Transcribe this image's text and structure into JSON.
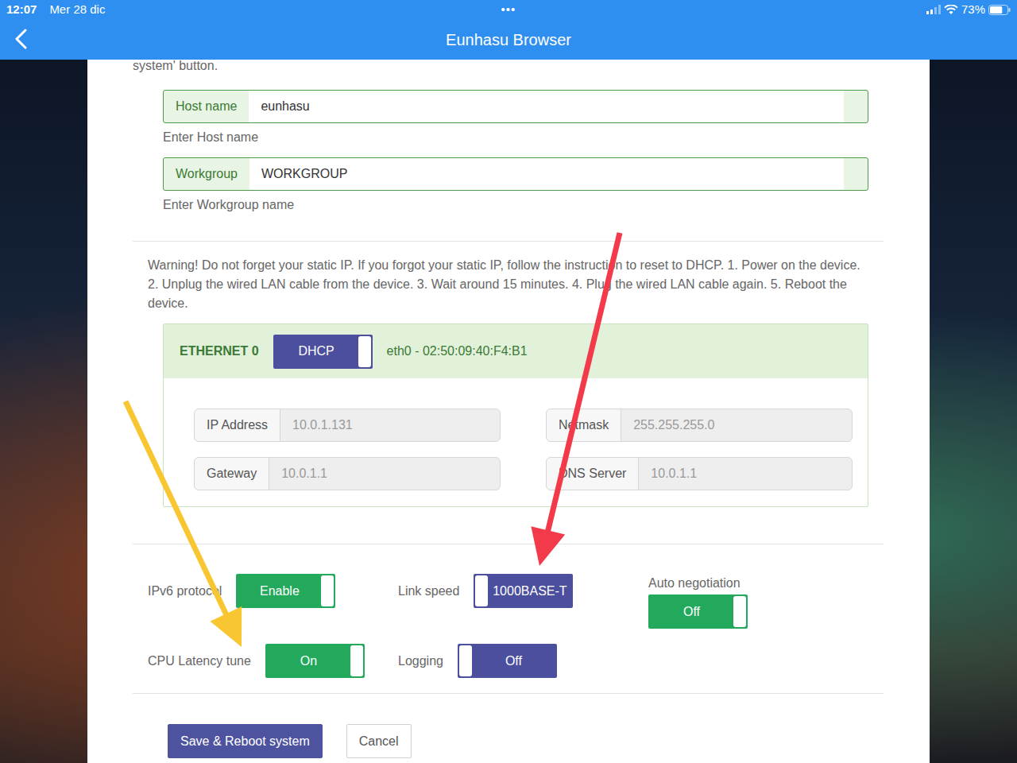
{
  "status_bar": {
    "time": "12:07",
    "date": "Mer 28 dic",
    "dots": "•••",
    "battery": "73%",
    "battery_level": 0.73
  },
  "nav_bar": {
    "title": "Eunhasu Browser"
  },
  "intro_tail": "system' button.",
  "fields": [
    {
      "label": "Host name",
      "value": "eunhasu",
      "help": "Enter Host name"
    },
    {
      "label": "Workgroup",
      "value": "WORKGROUP",
      "help": "Enter Workgroup name"
    }
  ],
  "warning": "Warning! Do not forget your static IP. If you forgot your static IP, follow the instruction to reset to DHCP. 1. Power on the device. 2. Unplug the wired LAN cable from the device. 3. Wait around 15 minutes. 4. Plug the wired LAN cable again. 5. Reboot the device.",
  "ethernet": {
    "title": "ETHERNET 0",
    "mode": {
      "text": "DHCP",
      "on": true,
      "color": "#4b4f9d"
    },
    "interface": "eth0 - 02:50:09:40:F4:B1",
    "fields": [
      {
        "label": "IP Address",
        "value": "10.0.1.131",
        "disabled": true
      },
      {
        "label": "Netmask",
        "value": "255.255.255.0",
        "disabled": true
      },
      {
        "label": "Gateway",
        "value": "10.0.1.1",
        "disabled": true
      },
      {
        "label": "DNS Server",
        "value": "10.0.1.1",
        "disabled": true
      }
    ]
  },
  "settings": [
    {
      "label": "IPv6 protocol",
      "toggle": "Enable",
      "on": true,
      "color": "#22a95b",
      "kind": "inline"
    },
    {
      "label": "Link speed",
      "toggle": "1000BASE-T",
      "on": false,
      "color": "#4b4f9d",
      "kind": "inline"
    },
    {
      "label": "Auto negotiation",
      "toggle": "Off",
      "on": true,
      "color": "#22a95b",
      "kind": "stacked"
    },
    {
      "label": "CPU Latency tune",
      "toggle": "On",
      "on": true,
      "color": "#22a95b",
      "kind": "inline"
    },
    {
      "label": "Logging",
      "toggle": "Off",
      "on": false,
      "color": "#4b4f9d",
      "kind": "inline"
    }
  ],
  "buttons": [
    {
      "label": "Save & Reboot system",
      "kind": "primary"
    },
    {
      "label": "Cancel",
      "kind": "secondary"
    }
  ],
  "annotations": [
    {
      "color": "#f23a4b"
    },
    {
      "color": "#f8c630"
    }
  ]
}
